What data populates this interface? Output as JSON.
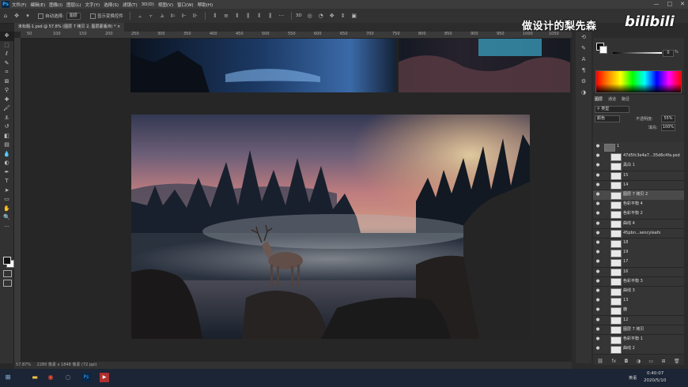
{
  "menubar": {
    "app_badge": "Ps",
    "items": [
      "文件(F)",
      "编辑(E)",
      "图像(I)",
      "图层(L)",
      "文字(Y)",
      "选择(S)",
      "滤镜(T)",
      "3D(D)",
      "视图(V)",
      "窗口(W)",
      "帮助(H)"
    ],
    "minimize": "—",
    "maximize": "□",
    "close": "✕"
  },
  "options": {
    "auto_select_label": "自动选择:",
    "auto_select_value": "图层",
    "show_transform_label": "显示变换控件"
  },
  "document": {
    "tab_title": "未标题-1.psd @ 57.8% (图层 7 拷贝 2, 图层蒙版/8) *",
    "ruler_labels": [
      "50",
      "100",
      "150",
      "200",
      "250",
      "300",
      "350",
      "400",
      "450",
      "500",
      "550",
      "600",
      "650",
      "700",
      "750",
      "800",
      "850",
      "900",
      "950",
      "1000",
      "1050"
    ],
    "zoom": "57.87%",
    "doc_size": "2280 像素 x 1848 像素 (72 ppi)"
  },
  "watermark": {
    "text": "做设计的梨先森",
    "brand": "bilibili"
  },
  "color_panel": {
    "opacity_value": "0",
    "opacity_unit": "%"
  },
  "layers_panel": {
    "tabs": [
      "图层",
      "通道",
      "路径"
    ],
    "filter_kind": "类型",
    "blend_mode": "颜色",
    "opacity_label": "不透明度:",
    "opacity_value": "55%",
    "fill_label": "填充:",
    "fill_value": "100%",
    "rows": [
      {
        "name": "1",
        "indent": 0,
        "group": true
      },
      {
        "name": "47d5fc3e4a7...35d6c4fa.psd",
        "indent": 1
      },
      {
        "name": "黑白 1",
        "indent": 1
      },
      {
        "name": "15",
        "indent": 1
      },
      {
        "name": "14",
        "indent": 1
      },
      {
        "name": "图层 7 拷贝 2",
        "indent": 1,
        "selected": true
      },
      {
        "name": "色彩平衡 4",
        "indent": 1
      },
      {
        "name": "色彩平衡 2",
        "indent": 1
      },
      {
        "name": "曲线 4",
        "indent": 1
      },
      {
        "name": "45pbn...sencyleafs",
        "indent": 1
      },
      {
        "name": "18",
        "indent": 1
      },
      {
        "name": "19",
        "indent": 1
      },
      {
        "name": "17",
        "indent": 1
      },
      {
        "name": "16",
        "indent": 1
      },
      {
        "name": "色彩平衡 3",
        "indent": 1
      },
      {
        "name": "曲线 3",
        "indent": 1
      },
      {
        "name": "13",
        "indent": 1
      },
      {
        "name": "鹿",
        "indent": 1
      },
      {
        "name": "12",
        "indent": 1
      },
      {
        "name": "图层 7 拷贝",
        "indent": 1
      },
      {
        "name": "色彩平衡 1",
        "indent": 1
      },
      {
        "name": "曲线 2",
        "indent": 1
      }
    ]
  },
  "taskbar": {
    "time": "0:40:07",
    "date": "2020/5/10",
    "ime": "英语"
  },
  "colors": {
    "accent": "#31a8ff",
    "selection": "#4a4a4a"
  }
}
